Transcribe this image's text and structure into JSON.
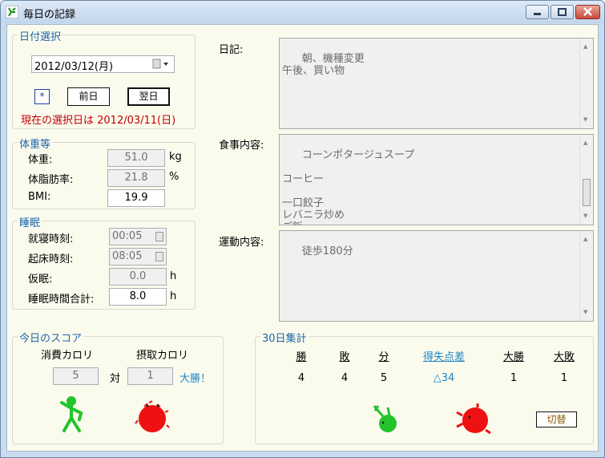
{
  "window": {
    "title": "毎日の記録"
  },
  "date_group": {
    "label": "日付選択",
    "date_value": "2012/03/12(月)",
    "star_label": "*",
    "prev_label": "前日",
    "next_label": "翌日",
    "current_text": "現在の選択日は 2012/03/11(日)"
  },
  "body_group": {
    "label": "体重等",
    "weight_label": "体重:",
    "weight_value": "51.0",
    "weight_unit": "kg",
    "fat_label": "体脂肪率:",
    "fat_value": "21.8",
    "fat_unit": "%",
    "bmi_label": "BMI:",
    "bmi_value": "19.9"
  },
  "sleep_group": {
    "label": "睡眠",
    "bedtime_label": "就寝時刻:",
    "bedtime_value": "00:05",
    "wake_label": "起床時刻:",
    "wake_value": "08:05",
    "nap_label": "仮眠:",
    "nap_value": "0.0",
    "nap_unit": "h",
    "total_label": "睡眠時間合計:",
    "total_value": "8.0",
    "total_unit": "h"
  },
  "diary": {
    "label": "日記:",
    "text": "朝、機種変更\n午後、買い物"
  },
  "meal": {
    "label": "食事内容:",
    "text": "コーンポタージュスープ\n\nコーヒー\n\n一口餃子\nレバニラ炒め\nご飯"
  },
  "exercise": {
    "label": "運動内容:",
    "text": "徒歩180分"
  },
  "today_score": {
    "label": "今日のスコア",
    "consumed_header": "消費カロリ",
    "intake_header": "摂取カロリ",
    "consumed_value": "5",
    "vs_label": "対",
    "intake_value": "1",
    "result": "大勝！"
  },
  "summary30": {
    "label": "30日集計",
    "headers": [
      "勝",
      "敗",
      "分",
      "得失点差",
      "大勝",
      "大敗"
    ],
    "values": [
      "4",
      "4",
      "5",
      "△34",
      "1",
      "1"
    ],
    "toggle_label": "切替"
  },
  "colors": {
    "accent_blue": "#1f65a9",
    "alert_red": "#c00000",
    "link_blue": "#1f84c6",
    "figure_green": "#22c42a",
    "figure_red": "#ee1111",
    "toggle_text": "#8b5a00"
  }
}
